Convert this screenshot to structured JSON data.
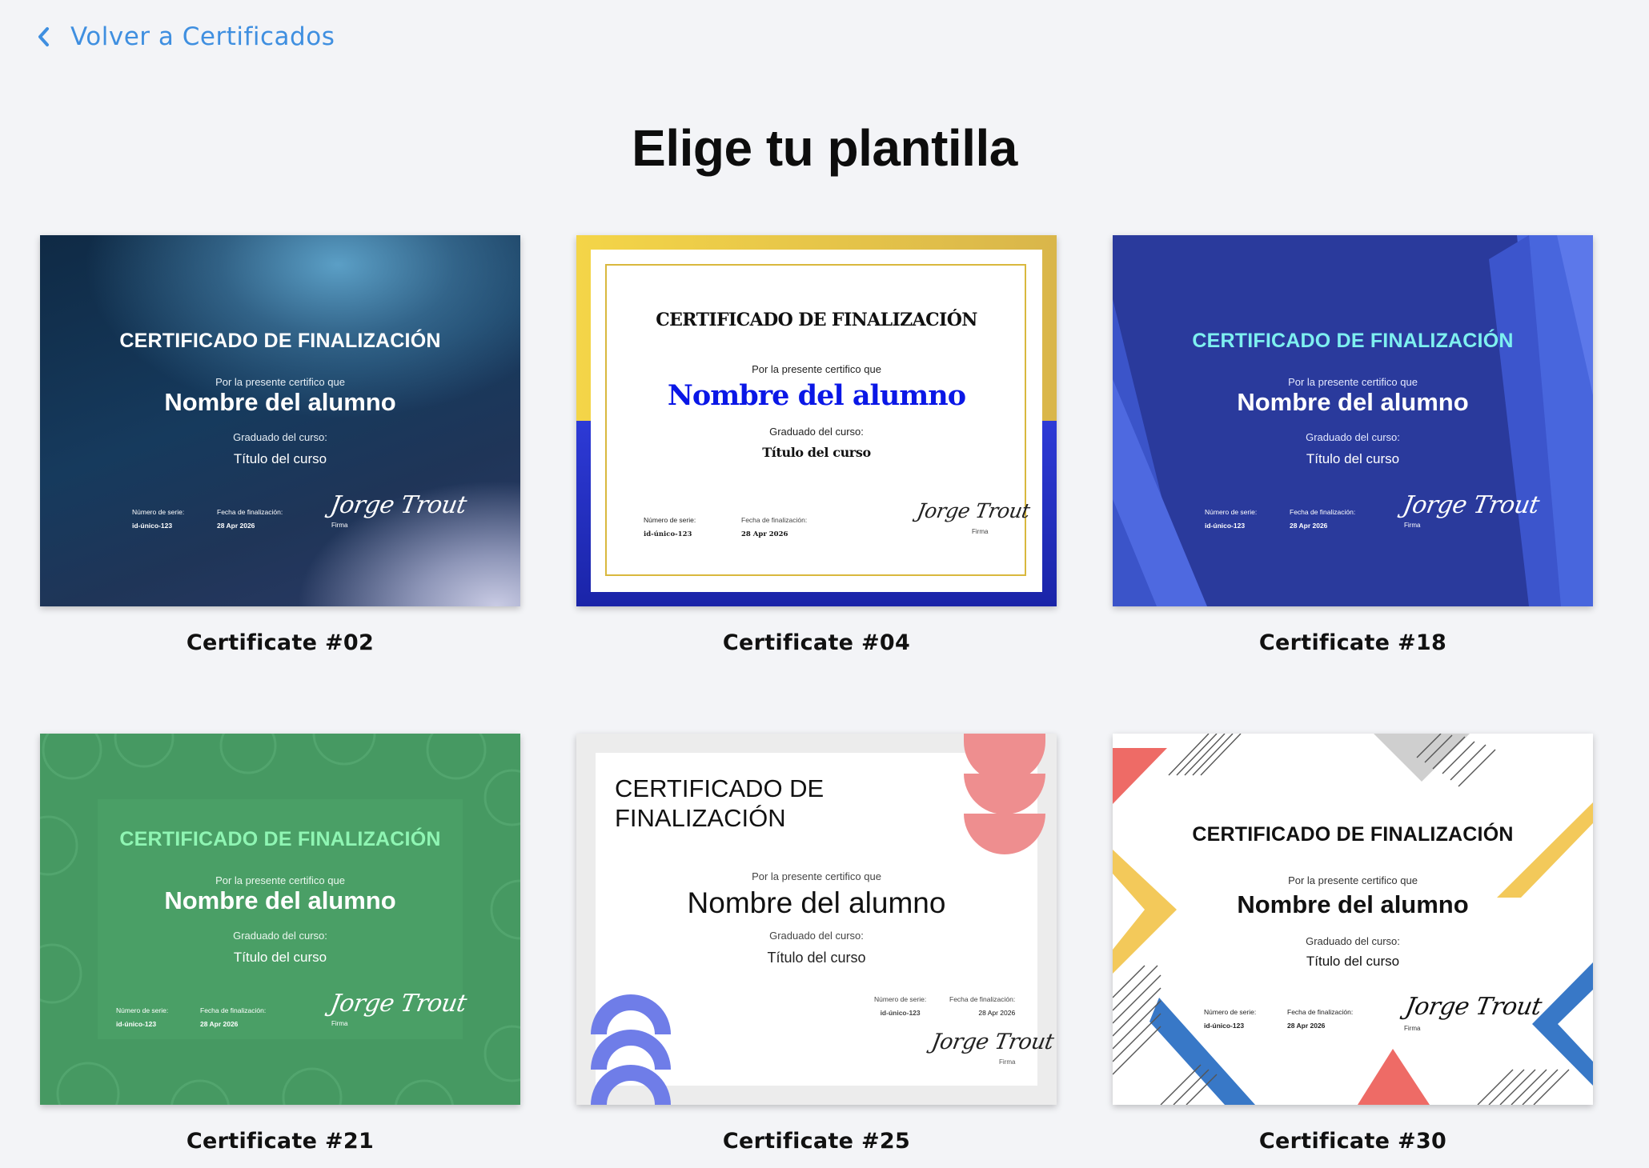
{
  "nav": {
    "back_label": "Volver a Certificados"
  },
  "page": {
    "title": "Elige tu plantilla"
  },
  "cert": {
    "title": "CERTIFICADO DE FINALIZACIÓN",
    "title_line1": "CERTIFICADO DE",
    "title_line2": "FINALIZACIÓN",
    "intro": "Por la presente certifico que",
    "student_name": "Nombre del alumno",
    "graduated_label": "Graduado del curso:",
    "course_title": "Título del curso",
    "serial_label": "Número de serie:",
    "serial_value": "id-único-123",
    "date_label": "Fecha de finalización:",
    "date_value": "28 Apr 2026",
    "signature": "Jorge Trout",
    "signature_label": "Firma"
  },
  "templates": [
    {
      "name": "Certificate #02"
    },
    {
      "name": "Certificate #04"
    },
    {
      "name": "Certificate #18"
    },
    {
      "name": "Certificate #21"
    },
    {
      "name": "Certificate #25"
    },
    {
      "name": "Certificate #30"
    }
  ],
  "colors": {
    "link": "#3f8fe0",
    "page_bg": "#f3f4f7",
    "navy": "#2a3a9c",
    "green": "#469962",
    "mint": "#8ff5b3",
    "cyan": "#7ef0f0",
    "royal_blue": "#0a17e6",
    "gold": "#e9c949",
    "coral": "#ef6b64",
    "yellow": "#f3c95a",
    "blue": "#3878c7",
    "periwinkle": "#6f7de8"
  },
  "icons": {
    "back": "chevron-left-icon"
  }
}
